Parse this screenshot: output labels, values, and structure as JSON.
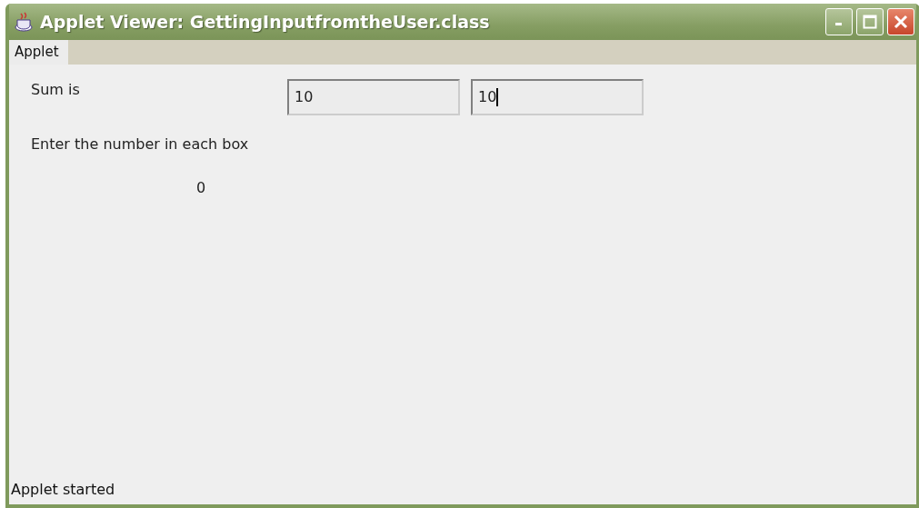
{
  "window": {
    "title": "Applet Viewer: GettingInputfromtheUser.class"
  },
  "menu": [
    {
      "label": "Applet"
    }
  ],
  "sum_label": "Sum is",
  "fields": [
    {
      "value": "10",
      "focused": false
    },
    {
      "value": "10",
      "focused": true
    }
  ],
  "instruction": "Enter the number in each box",
  "result": "0",
  "status_bar": "Applet started"
}
